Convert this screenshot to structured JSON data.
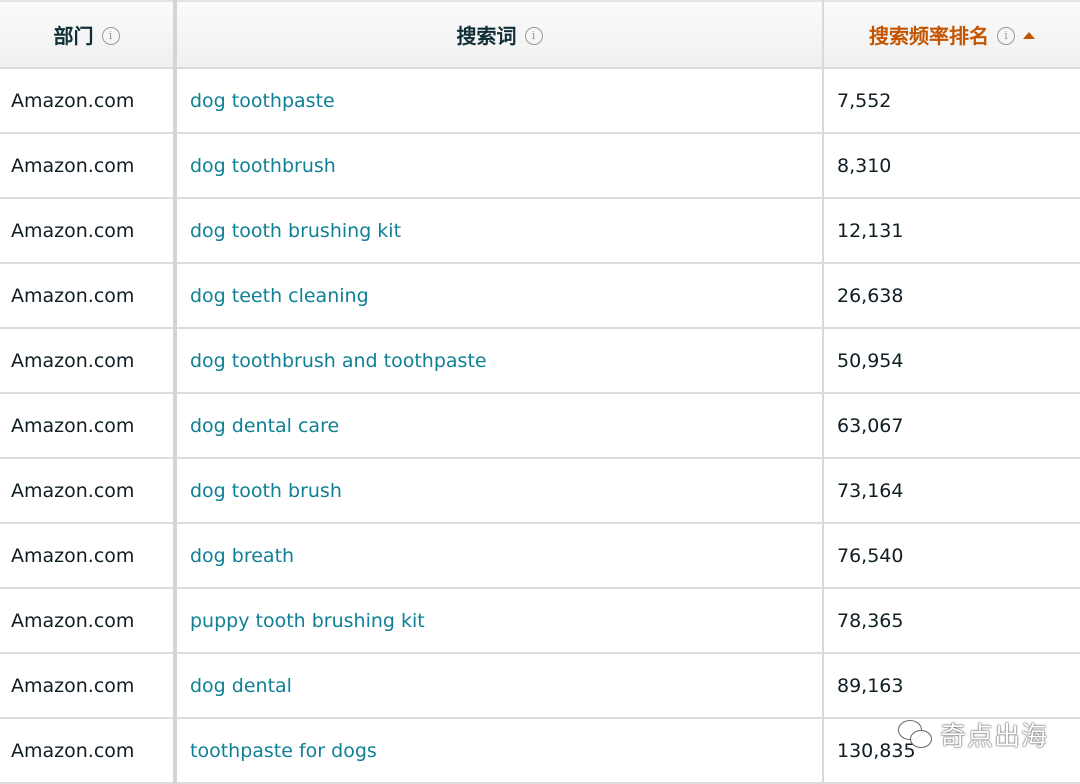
{
  "table": {
    "headers": [
      {
        "label": "部门",
        "info_icon": "info-icon"
      },
      {
        "label": "搜索词",
        "info_icon": "info-icon"
      },
      {
        "label": "搜索频率排名",
        "info_icon": "info-icon",
        "sort": "ascending",
        "sort_icon": "sort-asc-caret-icon"
      }
    ],
    "rows": [
      {
        "department": "Amazon.com",
        "search_term": "dog toothpaste",
        "rank": "7,552"
      },
      {
        "department": "Amazon.com",
        "search_term": "dog toothbrush",
        "rank": "8,310"
      },
      {
        "department": "Amazon.com",
        "search_term": "dog tooth brushing kit",
        "rank": "12,131"
      },
      {
        "department": "Amazon.com",
        "search_term": "dog teeth cleaning",
        "rank": "26,638"
      },
      {
        "department": "Amazon.com",
        "search_term": "dog toothbrush and toothpaste",
        "rank": "50,954"
      },
      {
        "department": "Amazon.com",
        "search_term": "dog dental care",
        "rank": "63,067"
      },
      {
        "department": "Amazon.com",
        "search_term": "dog tooth brush",
        "rank": "73,164"
      },
      {
        "department": "Amazon.com",
        "search_term": "dog breath",
        "rank": "76,540"
      },
      {
        "department": "Amazon.com",
        "search_term": "puppy tooth brushing kit",
        "rank": "78,365"
      },
      {
        "department": "Amazon.com",
        "search_term": "dog dental",
        "rank": "89,163"
      },
      {
        "department": "Amazon.com",
        "search_term": "toothpaste for dogs",
        "rank": "130,835"
      }
    ]
  },
  "colors": {
    "link": "#0f8096",
    "sorted_header": "#c45500",
    "text": "#0f1e24"
  },
  "watermark": {
    "icon": "wechat-icon",
    "text": "奇点出海"
  }
}
